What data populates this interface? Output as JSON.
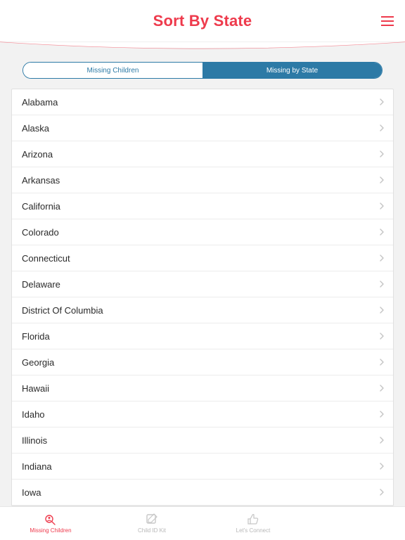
{
  "header": {
    "title": "Sort By State"
  },
  "segmented": {
    "options": [
      {
        "label": "Missing Children",
        "active": false
      },
      {
        "label": "Missing by State",
        "active": true
      }
    ]
  },
  "states": [
    "Alabama",
    "Alaska",
    "Arizona",
    "Arkansas",
    "California",
    "Colorado",
    "Connecticut",
    "Delaware",
    "District Of Columbia",
    "Florida",
    "Georgia",
    "Hawaii",
    "Idaho",
    "Illinois",
    "Indiana",
    "Iowa"
  ],
  "tabbar": {
    "items": [
      {
        "label": "Missing Children",
        "icon": "search-person",
        "active": true
      },
      {
        "label": "Child ID Kit",
        "icon": "edit-square",
        "active": false
      },
      {
        "label": "Let's Connect",
        "icon": "thumbs-up",
        "active": false
      },
      {
        "label": "",
        "icon": "",
        "active": false
      }
    ]
  },
  "colors": {
    "accent": "#ee3a4c",
    "segmented": "#2d7aa6"
  }
}
